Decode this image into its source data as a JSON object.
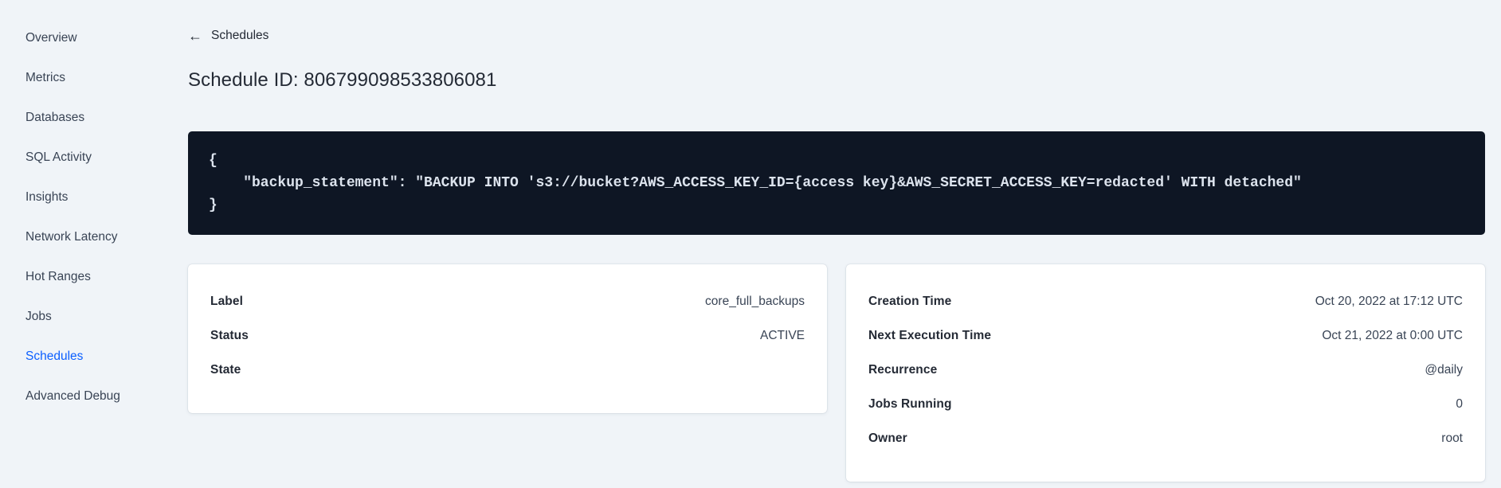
{
  "sidebar": {
    "items": [
      {
        "label": "Overview"
      },
      {
        "label": "Metrics"
      },
      {
        "label": "Databases"
      },
      {
        "label": "SQL Activity"
      },
      {
        "label": "Insights"
      },
      {
        "label": "Network Latency"
      },
      {
        "label": "Hot Ranges"
      },
      {
        "label": "Jobs"
      },
      {
        "label": "Schedules"
      },
      {
        "label": "Advanced Debug"
      }
    ],
    "active_item": "Schedules",
    "active_color": "#0b5fff"
  },
  "header": {
    "back_icon": "←",
    "back_label": "Schedules",
    "title": "Schedule ID: 806799098533806081"
  },
  "code_block": {
    "background": "#0e1624",
    "text": "{\n    \"backup_statement\": \"BACKUP INTO 's3://bucket?AWS_ACCESS_KEY_ID={access key}&AWS_SECRET_ACCESS_KEY=redacted' WITH detached\"\n}"
  },
  "cards": {
    "schedule": {
      "rows": [
        {
          "label": "Label",
          "value": "core_full_backups"
        },
        {
          "label": "Status",
          "value": "ACTIVE"
        },
        {
          "label": "State",
          "value": ""
        }
      ]
    },
    "execution": {
      "rows": [
        {
          "label": "Creation Time",
          "value": "Oct 20, 2022 at 17:12 UTC"
        },
        {
          "label": "Next Execution Time",
          "value": "Oct 21, 2022 at 0:00 UTC"
        },
        {
          "label": "Recurrence",
          "value": "@daily"
        },
        {
          "label": "Jobs Running",
          "value": "0"
        },
        {
          "label": "Owner",
          "value": "root"
        }
      ]
    }
  }
}
